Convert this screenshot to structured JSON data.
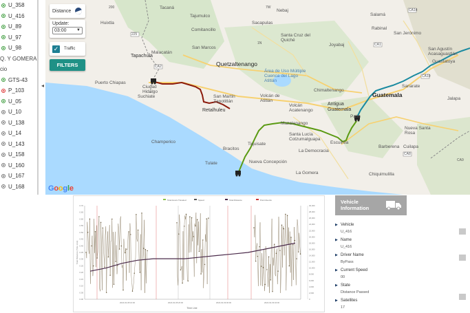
{
  "vehicle_list": {
    "items": [
      {
        "label": "U_358",
        "status": "green"
      },
      {
        "label": "U_416",
        "status": "green"
      },
      {
        "label": "U_89",
        "status": "green"
      },
      {
        "label": "U_97",
        "status": "green"
      },
      {
        "label": "U_98",
        "status": "green"
      },
      {
        "label": "Q. Y GOMERA",
        "status": "group"
      },
      {
        "label": "cio",
        "status": "group"
      },
      {
        "label": "GTS-43",
        "status": "green"
      },
      {
        "label": "P_103",
        "status": "red"
      },
      {
        "label": "U_05",
        "status": "green"
      },
      {
        "label": "U_10",
        "status": "gray"
      },
      {
        "label": "U_138",
        "status": "gray"
      },
      {
        "label": "U_14",
        "status": "gray"
      },
      {
        "label": "U_143",
        "status": "gray"
      },
      {
        "label": "U_158",
        "status": "gray"
      },
      {
        "label": "U_160",
        "status": "gray"
      },
      {
        "label": "U_167",
        "status": "gray"
      },
      {
        "label": "U_168",
        "status": "gray"
      }
    ],
    "collapse_icon": "chevron-left-icon"
  },
  "map_controls": {
    "distance_label": "Distance",
    "update_label": "Update:",
    "update_value": "03:00",
    "traffic_label": "Traffic",
    "traffic_checked": true,
    "filters_label": "FILTERS"
  },
  "map": {
    "labels": {
      "tacana": "Tacaná",
      "tajumulco": "Tajumulco",
      "comitancillo": "Comitancillo",
      "huixtla": "Huixtla",
      "tapachula": "Tapachula",
      "malacatan": "Malacatán",
      "san_marcos": "San Marcos",
      "quetzaltenango": "Quetzaltenango",
      "puerto_chiapas": "Puerto Chiapas",
      "ciudad_hidalgo": "Ciudad Hidalgo",
      "suchiate": "Suchiate",
      "san_martin": "San Martín Zapotitlán",
      "retalhuleu": "Retalhuleu",
      "nebaj": "Nebaj",
      "sacapulas": "Sacapulas",
      "santa_cruz": "Santa Cruz del Quiché",
      "joyabaj": "Joyabaj",
      "rabinal": "Rabinal",
      "salama": "Salamá",
      "san_jeronimo": "San Jerónimo",
      "area_atitlan": "Área de Uso Múltiple Cuenca del Lago Atitlán",
      "volcan_atitlan": "Volcán de Atitlán",
      "chimaltenango": "Chimaltenango",
      "volcan_acatenango": "Volcán Acatenango",
      "antigua": "Antigua Guatemala",
      "guatemala": "Guatemala",
      "palin": "Palín",
      "mazatenango": "Mazatenango",
      "santa_lucia": "Santa Lucía Cotzumalguapa",
      "champerico": "Champerico",
      "bracitos": "Bracitos",
      "tiquisate": "Tiquisate",
      "nueva_concepcion": "Nueva Concepción",
      "la_democracia": "La Democracia",
      "escuintla": "Escuintla",
      "tulate": "Tulate",
      "la_gomera": "La Gomera",
      "san_agustin": "San Agustín Acasaguastlán",
      "guastatoya": "Guastatoya",
      "sanarate": "Sanarate",
      "jalapa": "Jalapa",
      "nueva_santa_rosa": "Nueva Santa Rosa",
      "cuilapa": "Cuilapa",
      "chiquimulilla": "Chiquimulilla",
      "barberena": "Barberena",
      "ca1": "CA1",
      "ca2": "CA2",
      "ca9": "CA9",
      "ca14": "CA14",
      "ca19": "CA19",
      "ca8": "CA8",
      "r225": "225",
      "r200": "200",
      "r7w": "7W",
      "r1n": "1N"
    },
    "route_colors": {
      "brown": "#8b1a0c",
      "green": "#5a9a12",
      "teal": "#1a8aa0"
    },
    "google_logo": [
      "G",
      "o",
      "o",
      "g",
      "l",
      "e"
    ]
  },
  "chart": {
    "legend": [
      "Total Hours Traveled",
      "Speed",
      "Total Distance",
      "Point Events"
    ],
    "xlabel": "Time Line",
    "ylabel_left": "Total Distance (Time Line)",
    "x_ticks": [
      "2024-02-08 16:00",
      "2024-02-08 20:00",
      "2024-02-09 00:00",
      "2024-02-09 04:00"
    ],
    "y_ticks_left": [
      "0.00",
      "0.05",
      "0.10",
      "0.15",
      "0.20",
      "0.25",
      "0.30",
      "0.35",
      "0.40",
      "0.45",
      "0.50",
      "0.55",
      "0.60",
      "0.65",
      "0.70"
    ],
    "y_ticks_right": [
      "0",
      "2,000",
      "4,000",
      "6,000",
      "8,000",
      "10,000",
      "12,000",
      "14,000",
      "16,000",
      "18,000",
      "20,000",
      "22,000",
      "24,000",
      "26,000",
      "28,000",
      "30,000"
    ]
  },
  "chart_data": {
    "type": "line",
    "title": "",
    "xlabel": "Time Line",
    "ylabel": "Total Distance (Time Line)",
    "series": [
      {
        "name": "Total Distance",
        "values": [
          9000,
          10000,
          11500,
          12500,
          13000,
          13000,
          13000,
          13500,
          14000,
          14500,
          15000,
          16000,
          17000,
          18000
        ]
      }
    ]
  },
  "vehicle_info": {
    "title_line1": "Vehicle",
    "title_line2": "Information",
    "truck_icon": "truck-icon",
    "fields": [
      {
        "label": "Vehicle",
        "value": "U_416"
      },
      {
        "label": "Name",
        "value": "U_416"
      },
      {
        "label": "Driver Name",
        "value": "ByPass"
      },
      {
        "label": "Current Speed",
        "value": "00"
      },
      {
        "label": "State",
        "value": "Distance Passed"
      },
      {
        "label": "Satellites",
        "value": "17"
      }
    ]
  }
}
